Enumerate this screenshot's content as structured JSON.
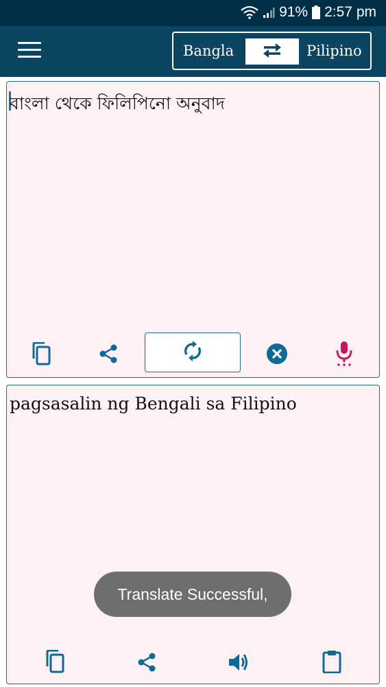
{
  "status_bar": {
    "battery": "91%",
    "time": "2:57 pm",
    "icons": [
      "wifi-icon",
      "signal-icon",
      "battery-icon"
    ]
  },
  "app_bar": {
    "source_language": "Bangla",
    "target_language": "Pilipino",
    "icons": [
      "menu-icon",
      "swap-icon"
    ]
  },
  "input_panel": {
    "text": "বাংলা থেকে ফিলিপিনো অনুবাদ",
    "icons": [
      "copy-icon",
      "share-icon",
      "translate-refresh-icon",
      "clear-icon",
      "mic-icon"
    ]
  },
  "output_panel": {
    "text": "pagsasalin ng Bengali sa Filipino",
    "icons": [
      "copy-icon",
      "share-icon",
      "speaker-icon",
      "clipboard-icon"
    ]
  },
  "toast": {
    "message": "Translate Successful,"
  },
  "colors": {
    "status_bar": "#002f47",
    "app_bar": "#0b4561",
    "accent": "#0f6b93",
    "mic": "#c2185b",
    "panel_bg": "#fdf1f4",
    "toast_bg": "#6e6e6e"
  }
}
